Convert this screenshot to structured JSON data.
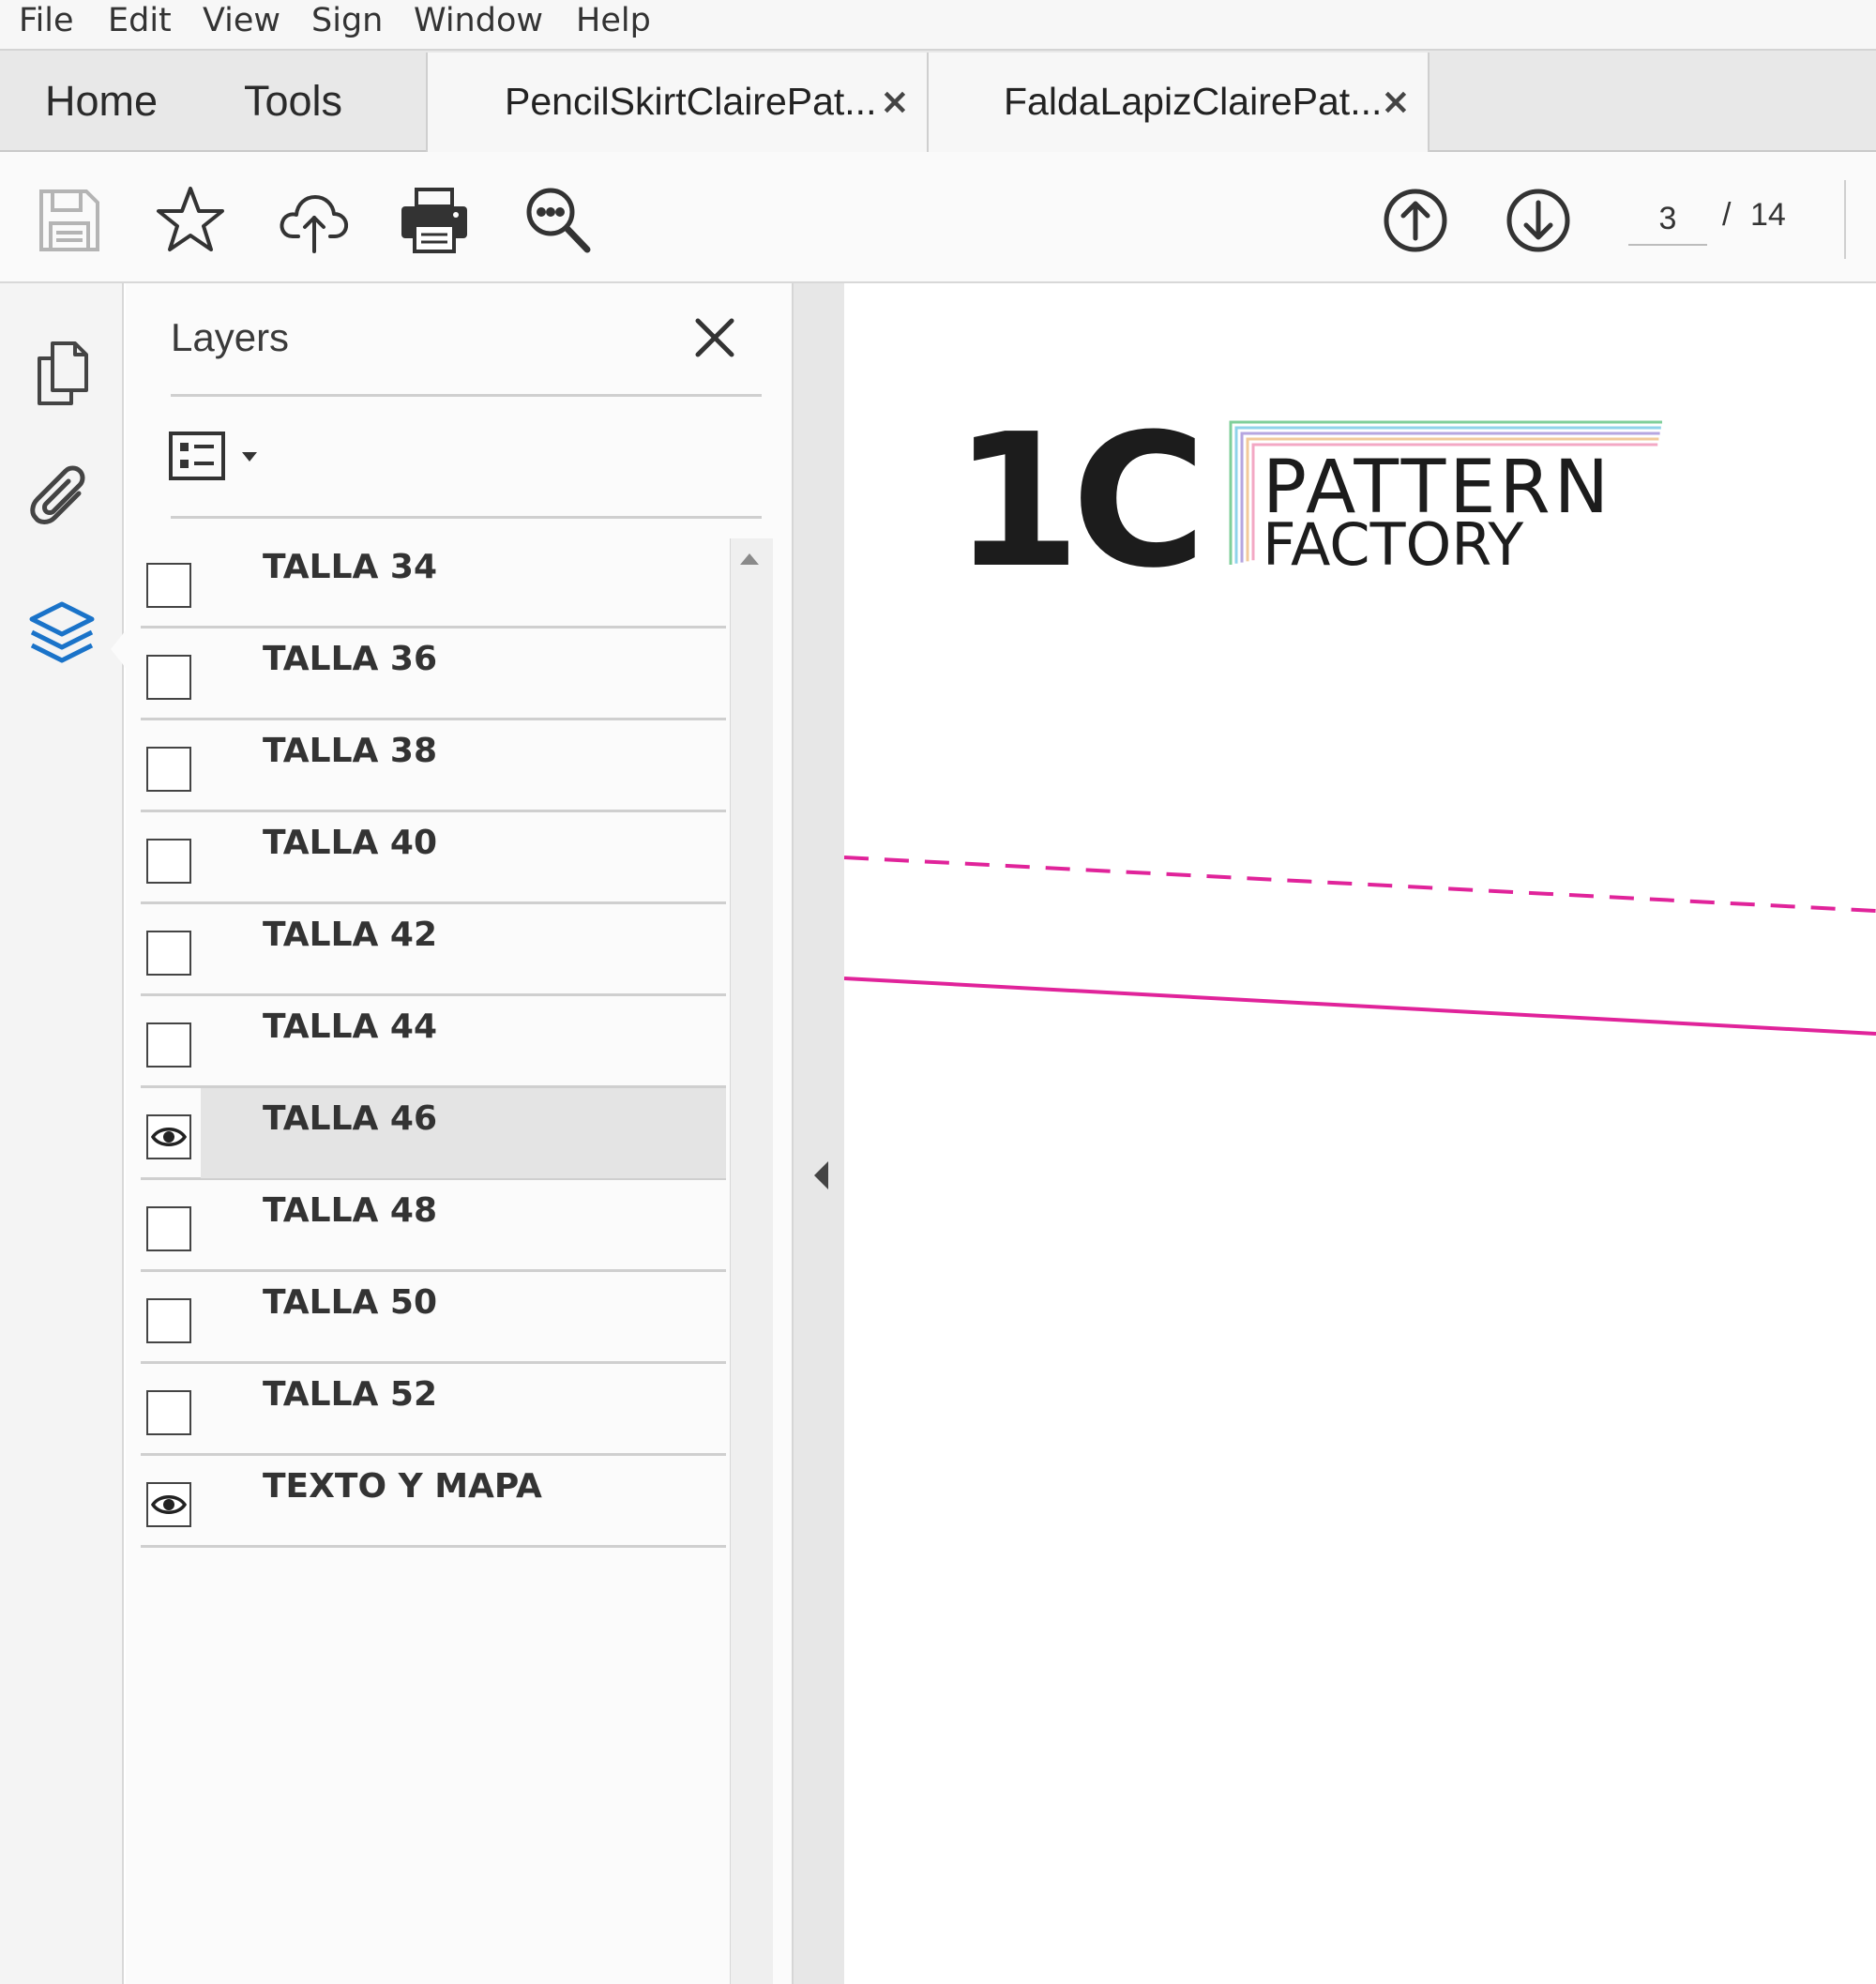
{
  "menu": {
    "items": [
      "File",
      "Edit",
      "View",
      "Sign",
      "Window",
      "Help"
    ]
  },
  "tabs": {
    "home": "Home",
    "tools": "Tools",
    "documents": [
      {
        "title": "PencilSkirtClairePat...",
        "close": "×"
      },
      {
        "title": "FaldaLapizClairePat...",
        "close": "×"
      }
    ]
  },
  "toolbar": {
    "icons": [
      "save-icon",
      "bookmark-star-icon",
      "upload-cloud-icon",
      "print-icon",
      "search-zoom-icon",
      "previous-page-icon",
      "next-page-icon"
    ],
    "current_page": "3",
    "separator": "/",
    "total_pages": "14"
  },
  "left_rail": {
    "icons": [
      "pages-icon",
      "attachments-icon",
      "layers-icon"
    ],
    "active": "layers-icon",
    "active_color": "#1a73c9"
  },
  "layers_panel": {
    "title": "Layers",
    "layers": [
      {
        "label": "TALLA 34",
        "visible": false
      },
      {
        "label": "TALLA 36",
        "visible": false
      },
      {
        "label": "TALLA 38",
        "visible": false
      },
      {
        "label": "TALLA 40",
        "visible": false
      },
      {
        "label": "TALLA 42",
        "visible": false
      },
      {
        "label": "TALLA 44",
        "visible": false
      },
      {
        "label": "TALLA 46",
        "visible": true,
        "selected": true
      },
      {
        "label": "TALLA 48",
        "visible": false
      },
      {
        "label": "TALLA 50",
        "visible": false
      },
      {
        "label": "TALLA 52",
        "visible": false
      },
      {
        "label": "TEXTO Y MAPA",
        "visible": true
      }
    ]
  },
  "document": {
    "logo_mark": "1C",
    "logo_line1": "PATTERN",
    "logo_line2": "FACTORY",
    "logo_stripe_colors": [
      "#7fcf9a",
      "#8fd3ea",
      "#b6a6e0",
      "#f2c99a",
      "#f3a8c4"
    ],
    "pattern_line_color": "#e0239a"
  }
}
